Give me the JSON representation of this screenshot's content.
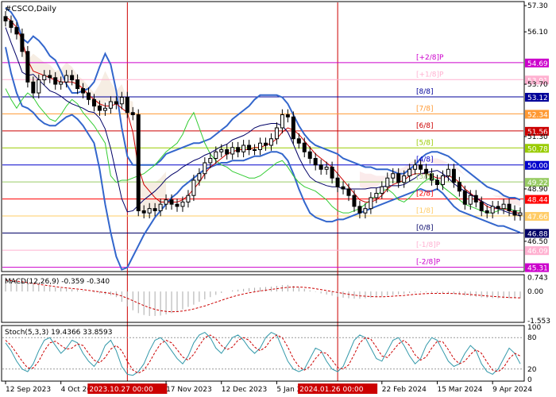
{
  "window": {
    "title": "#CSCO,Daily",
    "macd_label": "MACD(12,26,9) -0.359 -0.340",
    "stoch_label": "Stoch(5,3,3) 19.4366 33.8593"
  },
  "colors": {
    "candle": "#000000",
    "bollinger": "#3366cc",
    "ma_red": "#cc0000",
    "ma_green": "#33cc33",
    "ichimoku_cloud": "#cc9966",
    "ichimoku_pink": "#f0b0b0",
    "murrey_plus2": "#cc00cc",
    "murrey_plus1": "#ffb0d0",
    "murrey_8": "#000099",
    "murrey_7": "#ff9933",
    "murrey_6": "#cc0000",
    "murrey_5": "#99cc00",
    "murrey_4": "#0000cc",
    "murrey_3": "#99cc66",
    "murrey_2": "#ff0000",
    "murrey_1": "#ffcc66",
    "murrey_0": "#000066",
    "murrey_minus1": "#ffb0d0",
    "murrey_minus2": "#cc00cc",
    "vline": "#cc0000",
    "macd_hist": "#aaaaaa",
    "macd_signal": "#cc0000",
    "stoch_main": "#3399aa",
    "stoch_signal": "#cc0000"
  },
  "chart_data": [
    {
      "type": "candlestick",
      "title": "#CSCO,Daily",
      "ylim": [
        45.15,
        57.45
      ],
      "y_ticks": [
        {
          "value": 57.3,
          "label": "57.30"
        },
        {
          "value": 56.1,
          "label": "56.10"
        },
        {
          "value": 53.7,
          "label": "53.70"
        },
        {
          "value": 51.3,
          "label": "51.30"
        },
        {
          "value": 48.9,
          "label": "48.90"
        },
        {
          "value": 46.5,
          "label": "46.50"
        }
      ],
      "x_ticks": [
        "12 Sep 2023",
        "4 Oct 2023",
        "2023.10.27 00:00",
        "17 Nov 2023",
        "12 Dec 2023",
        "5 Jan 2024",
        "2024.01.26 00:00",
        "22 Feb 2024",
        "15 Mar 2024",
        "9 Apr 2024"
      ],
      "murrey_levels": [
        {
          "label": "[+2/8]P",
          "value": 54.69,
          "price_label": "54.69",
          "color_key": "murrey_plus2"
        },
        {
          "label": "[+1/8]P",
          "value": 53.91,
          "price_label": "53.91",
          "color_key": "murrey_plus1"
        },
        {
          "label": "[8/8]",
          "value": 53.12,
          "price_label": "53.12",
          "color_key": "murrey_8"
        },
        {
          "label": "[7/8]",
          "value": 52.34,
          "price_label": "52.34",
          "color_key": "murrey_7"
        },
        {
          "label": "[6/8]",
          "value": 51.56,
          "price_label": "51.56",
          "color_key": "murrey_6"
        },
        {
          "label": "[5/8]",
          "value": 50.78,
          "price_label": "50.78",
          "color_key": "murrey_5"
        },
        {
          "label": "[4/8]",
          "value": 50.0,
          "price_label": "50.00",
          "color_key": "murrey_4"
        },
        {
          "label": "[3/8]",
          "value": 49.22,
          "price_label": "49.22",
          "color_key": "murrey_3"
        },
        {
          "label": "[2/8]",
          "value": 48.44,
          "price_label": "48.44",
          "color_key": "murrey_2"
        },
        {
          "label": "[1/8]",
          "value": 47.66,
          "price_label": "47.66",
          "color_key": "murrey_1"
        },
        {
          "label": "[0/8]",
          "value": 46.88,
          "price_label": "46.88",
          "color_key": "murrey_0"
        },
        {
          "label": "[-1/8]P",
          "value": 46.09,
          "price_label": "46.09",
          "color_key": "murrey_minus1"
        },
        {
          "label": "[-2/8]P",
          "value": 45.31,
          "price_label": "45.31",
          "color_key": "murrey_minus2"
        }
      ],
      "current_price": 47.66,
      "vertical_markers": [
        "2023.10.27 00:00",
        "2024.01.26 00:00"
      ],
      "close": [
        56.6,
        56.3,
        56.0,
        55.2,
        53.8,
        53.3,
        53.9,
        54.1,
        54.0,
        53.7,
        53.8,
        54.1,
        53.9,
        53.5,
        53.3,
        53.0,
        52.7,
        52.5,
        52.6,
        52.9,
        52.8,
        53.1,
        52.4,
        52.3,
        47.9,
        47.8,
        48.0,
        47.9,
        48.2,
        48.4,
        48.2,
        48.1,
        48.3,
        48.6,
        49.3,
        49.6,
        50.1,
        50.3,
        50.6,
        50.7,
        50.5,
        50.8,
        50.6,
        50.9,
        50.7,
        50.7,
        51.0,
        50.9,
        51.2,
        51.7,
        52.3,
        52.2,
        51.2,
        51.0,
        50.6,
        50.3,
        50.0,
        49.8,
        49.9,
        49.4,
        49.0,
        48.9,
        48.6,
        48.1,
        47.8,
        48.0,
        48.5,
        48.7,
        49.0,
        49.4,
        49.6,
        49.2,
        49.5,
        49.8,
        50.0,
        49.8,
        49.6,
        49.3,
        49.1,
        49.5,
        49.8,
        49.2,
        48.8,
        48.2,
        48.6,
        48.3,
        47.9,
        47.8,
        48.1,
        48.0,
        48.2,
        47.9,
        47.7,
        47.8
      ],
      "bb_upper": [
        57.2,
        57.0,
        56.6,
        55.8,
        55.6,
        55.9,
        55.7,
        55.4,
        55.0,
        54.8,
        54.3,
        53.7,
        53.3,
        53.3,
        53.4,
        53.5,
        53.8,
        54.5,
        55.1,
        54.6,
        53.4,
        51.7,
        50.4,
        50.0,
        50.0,
        50.0,
        50.0,
        50.0,
        50.2,
        50.5,
        50.6,
        50.7,
        50.8,
        50.9,
        51.0,
        51.0,
        51.1,
        51.2,
        51.4,
        51.6,
        51.8,
        52.1,
        52.3,
        52.5,
        52.7,
        53.0,
        53.2,
        53.2,
        53.2,
        53.2,
        53.1,
        52.8,
        52.3,
        51.8,
        51.4,
        51.1,
        50.9,
        50.8,
        50.7,
        50.6,
        50.5,
        50.3,
        50.2,
        50.1,
        50.0,
        49.9,
        49.9,
        49.8,
        49.8,
        49.8,
        49.7,
        49.6,
        49.6,
        49.8,
        50.0,
        50.3,
        50.5,
        50.6,
        50.6,
        50.5,
        50.4,
        50.2,
        50.0,
        49.8,
        49.6,
        49.4,
        49.2,
        49.0,
        48.9,
        48.8,
        48.6,
        48.5,
        48.5,
        48.4
      ],
      "bb_lower": [
        55.4,
        54.2,
        53.3,
        52.7,
        52.6,
        52.4,
        52.1,
        51.9,
        51.8,
        51.8,
        52.0,
        52.2,
        52.3,
        52.1,
        51.8,
        51.4,
        51.0,
        49.8,
        48.2,
        46.9,
        45.8,
        45.2,
        45.3,
        45.8,
        46.3,
        46.8,
        47.2,
        47.6,
        47.9,
        48.2,
        48.5,
        48.7,
        49.0,
        49.2,
        49.4,
        49.6,
        49.8,
        49.9,
        50.0,
        50.1,
        50.1,
        50.2,
        50.2,
        50.2,
        50.3,
        50.4,
        50.4,
        50.5,
        50.6,
        50.6,
        50.5,
        50.2,
        49.6,
        48.9,
        48.3,
        47.8,
        47.6,
        47.5,
        47.4,
        47.4,
        47.5,
        47.5,
        47.6,
        47.7,
        47.8,
        47.9,
        48.0,
        48.1,
        48.2,
        48.3,
        48.4,
        48.5,
        48.6,
        48.7,
        48.8,
        48.9,
        48.8,
        48.8,
        48.9,
        48.7,
        48.4,
        48.1,
        47.9,
        47.8,
        47.7,
        47.6,
        47.5,
        47.4,
        47.3,
        47.2,
        47.2,
        47.1,
        47.0,
        46.9
      ],
      "ma_red": [
        56.8,
        56.6,
        56.3,
        55.7,
        54.8,
        54.3,
        54.2,
        54.1,
        54.0,
        53.9,
        53.8,
        53.8,
        53.8,
        53.7,
        53.5,
        53.2,
        53.0,
        52.8,
        52.7,
        52.7,
        52.8,
        52.6,
        52.4,
        51.5,
        49.9,
        49.1,
        48.8,
        48.5,
        48.3,
        48.3,
        48.3,
        48.3,
        48.4,
        48.6,
        48.9,
        49.2,
        49.6,
        49.9,
        50.1,
        50.3,
        50.5,
        50.6,
        50.7,
        50.7,
        50.7,
        50.8,
        50.8,
        50.9,
        51.0,
        51.2,
        51.5,
        51.7,
        51.6,
        51.4,
        51.1,
        50.8,
        50.5,
        50.3,
        50.1,
        49.9,
        49.6,
        49.3,
        49.0,
        48.7,
        48.4,
        48.3,
        48.3,
        48.4,
        48.6,
        48.9,
        49.1,
        49.2,
        49.3,
        49.5,
        49.6,
        49.6,
        49.6,
        49.5,
        49.4,
        49.4,
        49.5,
        49.4,
        49.2,
        48.9,
        48.7,
        48.5,
        48.3,
        48.1,
        48.0,
        48.0,
        48.0,
        47.9,
        47.8,
        47.8
      ],
      "ma_green": [
        53.5,
        53.0,
        52.6,
        53.0,
        53.3,
        53.1,
        52.7,
        52.4,
        52.1,
        52.0,
        52.3,
        52.7,
        53.0,
        52.8,
        52.4,
        52.1,
        51.8,
        51.4,
        51.0,
        49.5,
        49.2,
        49.3,
        49.3,
        49.4,
        49.5,
        49.6,
        49.8,
        50.0,
        50.3,
        50.6,
        50.8,
        51.0,
        51.4,
        52.0,
        52.4,
        51.7,
        51.0,
        50.5,
        50.2,
        50.0,
        49.9,
        49.7,
        49.6,
        49.5,
        49.4,
        49.4,
        49.5,
        49.7,
        49.9,
        50.1,
        50.2,
        49.9,
        49.5,
        49.2,
        49.0,
        48.9,
        48.8,
        48.6,
        48.4,
        48.1,
        47.9,
        47.8,
        47.8,
        47.9,
        48.0,
        48.2,
        48.4,
        48.6,
        48.8,
        48.9,
        48.7,
        48.4,
        48.3,
        48.5,
        48.8,
        49.1,
        49.3,
        49.4,
        49.3,
        49.0,
        48.8,
        48.6,
        48.4,
        48.2,
        48.1,
        48.0,
        47.9,
        47.8,
        47.8,
        47.9,
        48.0,
        48.0,
        47.9,
        47.9
      ]
    },
    {
      "type": "line",
      "title": "MACD(12,26,9) -0.359 -0.340",
      "ylim": [
        -1.6,
        0.85
      ],
      "y_ticks": [
        {
          "value": 0.743,
          "label": "0.743"
        },
        {
          "value": 0.0,
          "label": "0.00"
        },
        {
          "value": -1.553,
          "label": "-1.553"
        }
      ],
      "histogram": [
        0.74,
        0.7,
        0.65,
        0.58,
        0.48,
        0.4,
        0.35,
        0.3,
        0.26,
        0.22,
        0.18,
        0.15,
        0.12,
        0.08,
        0.04,
        0.0,
        -0.05,
        -0.1,
        -0.15,
        -0.2,
        -0.3,
        -0.55,
        -0.8,
        -1.0,
        -1.15,
        -1.25,
        -1.3,
        -1.3,
        -1.28,
        -1.22,
        -1.15,
        -1.05,
        -0.95,
        -0.82,
        -0.7,
        -0.55,
        -0.42,
        -0.3,
        -0.18,
        -0.08,
        0.0,
        0.06,
        0.1,
        0.14,
        0.18,
        0.2,
        0.22,
        0.24,
        0.26,
        0.3,
        0.34,
        0.35,
        0.3,
        0.22,
        0.14,
        0.06,
        -0.02,
        -0.1,
        -0.16,
        -0.22,
        -0.28,
        -0.33,
        -0.36,
        -0.38,
        -0.38,
        -0.36,
        -0.33,
        -0.3,
        -0.26,
        -0.22,
        -0.18,
        -0.15,
        -0.12,
        -0.08,
        -0.05,
        -0.04,
        -0.04,
        -0.06,
        -0.08,
        -0.09,
        -0.1,
        -0.13,
        -0.17,
        -0.22,
        -0.25,
        -0.28,
        -0.31,
        -0.34,
        -0.35,
        -0.36,
        -0.36,
        -0.36,
        -0.36,
        -0.36
      ],
      "signal": [
        0.6,
        0.58,
        0.55,
        0.52,
        0.47,
        0.42,
        0.38,
        0.34,
        0.3,
        0.26,
        0.22,
        0.19,
        0.16,
        0.13,
        0.1,
        0.06,
        0.02,
        -0.02,
        -0.06,
        -0.1,
        -0.15,
        -0.24,
        -0.36,
        -0.49,
        -0.62,
        -0.75,
        -0.86,
        -0.95,
        -1.02,
        -1.06,
        -1.08,
        -1.07,
        -1.04,
        -0.99,
        -0.93,
        -0.85,
        -0.77,
        -0.67,
        -0.57,
        -0.47,
        -0.37,
        -0.28,
        -0.2,
        -0.13,
        -0.07,
        -0.02,
        0.03,
        0.07,
        0.11,
        0.15,
        0.19,
        0.22,
        0.24,
        0.24,
        0.22,
        0.19,
        0.15,
        0.1,
        0.05,
        0.0,
        -0.05,
        -0.1,
        -0.15,
        -0.19,
        -0.23,
        -0.25,
        -0.27,
        -0.28,
        -0.28,
        -0.27,
        -0.25,
        -0.23,
        -0.21,
        -0.18,
        -0.15,
        -0.13,
        -0.11,
        -0.1,
        -0.1,
        -0.1,
        -0.1,
        -0.11,
        -0.12,
        -0.14,
        -0.16,
        -0.19,
        -0.21,
        -0.24,
        -0.26,
        -0.28,
        -0.3,
        -0.32,
        -0.33,
        -0.34
      ]
    },
    {
      "type": "line",
      "title": "Stoch(5,3,3) 19.4366 33.8593",
      "ylim": [
        0,
        100
      ],
      "y_ticks": [
        {
          "value": 100,
          "label": "100"
        },
        {
          "value": 80,
          "label": "80"
        },
        {
          "value": 20,
          "label": "20"
        },
        {
          "value": 0,
          "label": "0"
        }
      ],
      "levels": [
        80,
        20
      ],
      "main": [
        70,
        55,
        35,
        20,
        15,
        30,
        55,
        75,
        80,
        65,
        50,
        60,
        75,
        70,
        50,
        35,
        25,
        40,
        65,
        75,
        55,
        25,
        10,
        8,
        15,
        30,
        55,
        75,
        80,
        70,
        55,
        40,
        30,
        45,
        70,
        85,
        90,
        80,
        60,
        50,
        65,
        80,
        85,
        75,
        60,
        50,
        60,
        80,
        90,
        85,
        60,
        35,
        20,
        15,
        20,
        40,
        60,
        55,
        35,
        20,
        15,
        25,
        50,
        75,
        85,
        80,
        60,
        40,
        35,
        55,
        75,
        80,
        65,
        45,
        30,
        40,
        65,
        80,
        75,
        55,
        35,
        25,
        30,
        50,
        65,
        55,
        30,
        15,
        10,
        20,
        40,
        60,
        50,
        30
      ],
      "signal": [
        75,
        65,
        50,
        35,
        22,
        22,
        35,
        55,
        70,
        73,
        65,
        58,
        60,
        68,
        65,
        50,
        37,
        32,
        42,
        58,
        65,
        55,
        35,
        18,
        12,
        18,
        33,
        52,
        68,
        75,
        70,
        57,
        43,
        37,
        48,
        65,
        80,
        85,
        78,
        65,
        57,
        62,
        75,
        80,
        75,
        62,
        55,
        62,
        77,
        85,
        80,
        62,
        40,
        25,
        18,
        25,
        40,
        52,
        50,
        37,
        23,
        20,
        28,
        48,
        70,
        80,
        77,
        62,
        45,
        42,
        55,
        68,
        75,
        65,
        47,
        37,
        43,
        60,
        73,
        72,
        57,
        40,
        30,
        35,
        48,
        57,
        50,
        33,
        18,
        15,
        23,
        40,
        50,
        45
      ]
    }
  ]
}
